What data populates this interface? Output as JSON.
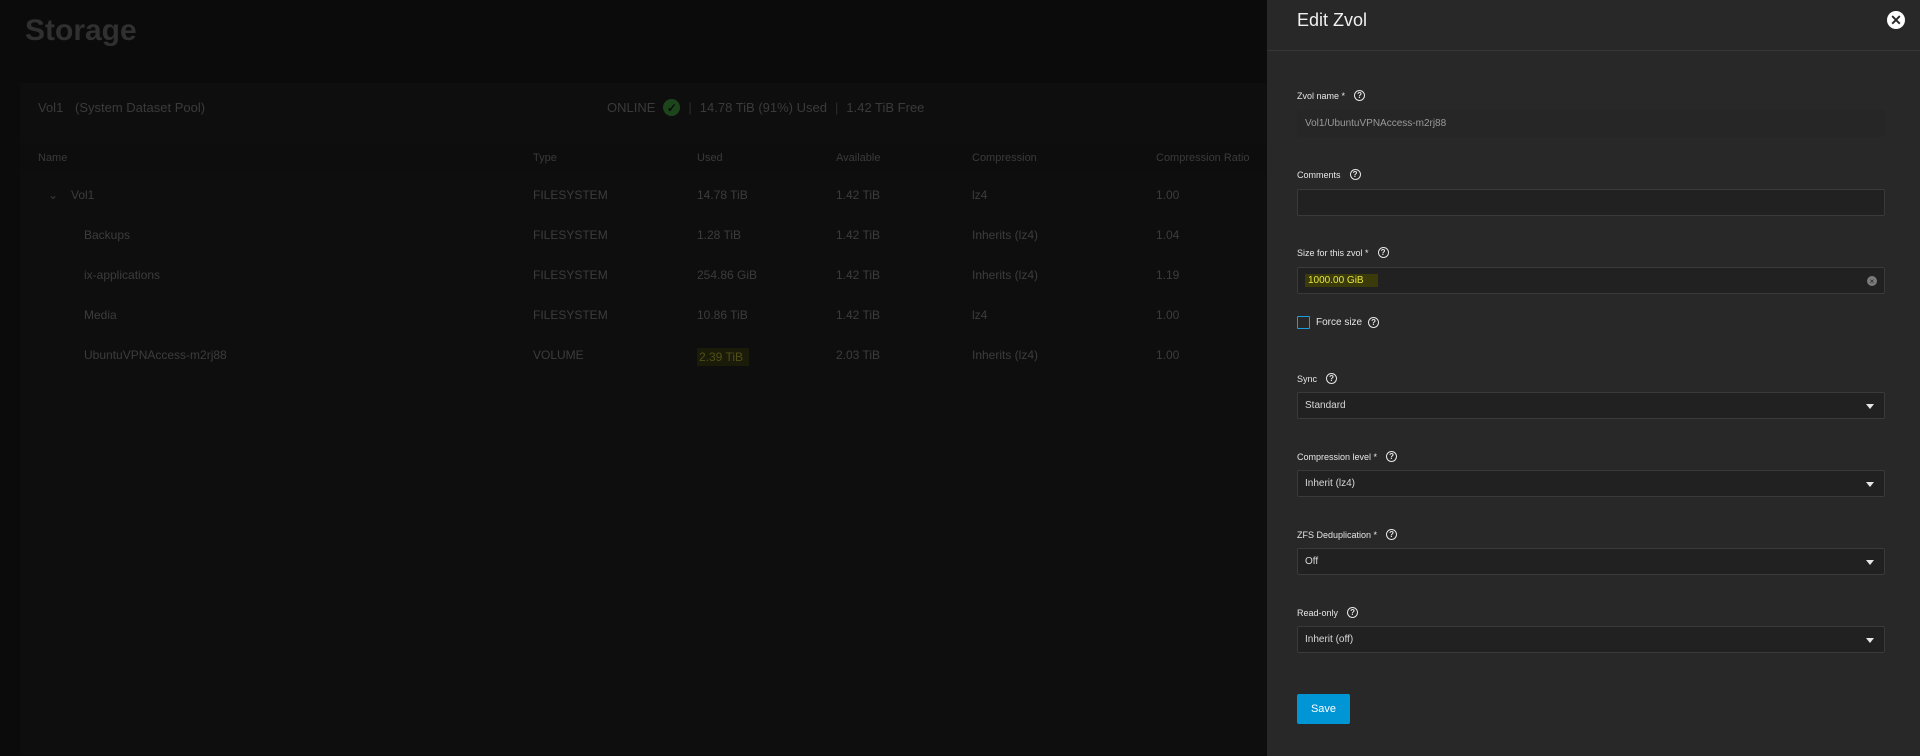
{
  "page": {
    "title": "Storage"
  },
  "pool": {
    "name": "Vol1",
    "subtitle": "(System Dataset Pool)",
    "status": "ONLINE",
    "used": "14.78 TiB (91%) Used",
    "free": "1.42 TiB Free",
    "separator": "|"
  },
  "table": {
    "columns": [
      "Name",
      "Type",
      "Used",
      "Available",
      "Compression",
      "Compression Ratio"
    ],
    "rows": [
      {
        "name": "Vol1",
        "type": "FILESYSTEM",
        "used": "14.78 TiB",
        "available": "1.42 TiB",
        "compression": "lz4",
        "ratio": "1.00"
      },
      {
        "name": "Backups",
        "type": "FILESYSTEM",
        "used": "1.28 TiB",
        "available": "1.42 TiB",
        "compression": "Inherits (lz4)",
        "ratio": "1.04"
      },
      {
        "name": "ix-applications",
        "type": "FILESYSTEM",
        "used": "254.86 GiB",
        "available": "1.42 TiB",
        "compression": "Inherits (lz4)",
        "ratio": "1.19"
      },
      {
        "name": "Media",
        "type": "FILESYSTEM",
        "used": "10.86 TiB",
        "available": "1.42 TiB",
        "compression": "lz4",
        "ratio": "1.00"
      },
      {
        "name": "UbuntuVPNAccess-m2rj88",
        "type": "VOLUME",
        "used": "2.39 TiB",
        "available": "2.03 TiB",
        "compression": "Inherits (lz4)",
        "ratio": "1.00"
      }
    ]
  },
  "panel": {
    "title": "Edit Zvol",
    "zvol_name": {
      "label": "Zvol name *",
      "value": "Vol1/UbuntuVPNAccess-m2rj88"
    },
    "comments": {
      "label": "Comments",
      "value": ""
    },
    "size": {
      "label": "Size for this zvol *",
      "value": "1000.00 GiB"
    },
    "force_size": {
      "label": "Force size",
      "checked": false
    },
    "sync": {
      "label": "Sync",
      "value": "Standard"
    },
    "compression": {
      "label": "Compression level *",
      "value": "Inherit (lz4)"
    },
    "dedup": {
      "label": "ZFS Deduplication *",
      "value": "Off"
    },
    "readonly": {
      "label": "Read-only",
      "value": "Inherit (off)"
    },
    "save_label": "Save"
  },
  "colors": {
    "accent": "#0095d5",
    "ok": "#2b6b2b",
    "highlight": "#e8e83a"
  }
}
